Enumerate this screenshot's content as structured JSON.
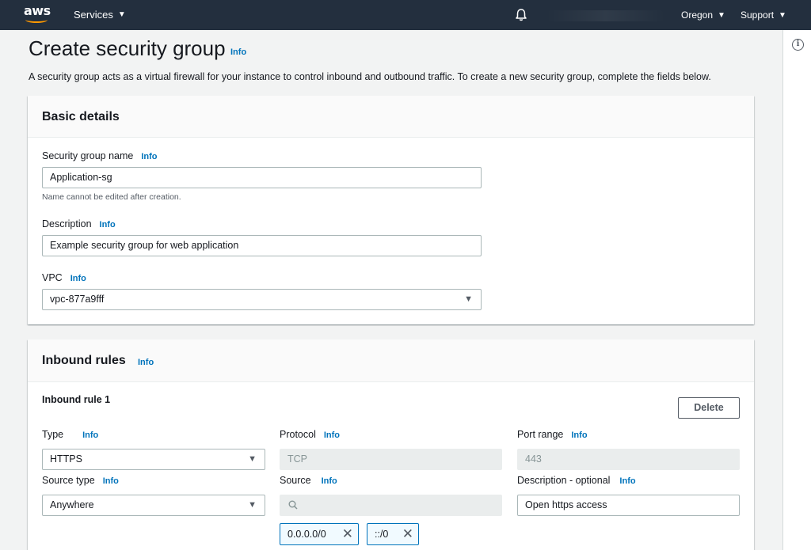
{
  "nav": {
    "services_label": "Services",
    "region_label": "Oregon",
    "support_label": "Support",
    "logo_text": "aws"
  },
  "colors": {
    "nav_bg": "#232f3e",
    "link": "#0073bb",
    "brand_orange": "#ff9900"
  },
  "icons": {
    "services_caret": "caret-down-icon",
    "bell": "bell-icon",
    "tools": "info-circle-icon",
    "select_caret": "caret-down-icon",
    "search": "search-icon",
    "token_remove": "close-icon"
  },
  "page": {
    "title": "Create security group",
    "info": "Info",
    "description": "A security group acts as a virtual firewall for your instance to control inbound and outbound traffic. To create a new security group, complete the fields below."
  },
  "basic_details": {
    "title": "Basic details",
    "name_label": "Security group name",
    "name_info": "Info",
    "name_value": "Application-sg",
    "name_hint": "Name cannot be edited after creation.",
    "description_label": "Description",
    "description_info": "Info",
    "description_value": "Example security group for web application",
    "vpc_label": "VPC",
    "vpc_info": "Info",
    "vpc_value": "vpc-877a9fff"
  },
  "inbound_rules": {
    "title": "Inbound rules",
    "info": "Info",
    "rule_title": "Inbound rule 1",
    "delete_label": "Delete",
    "type_label": "Type",
    "type_info": "Info",
    "type_value": "HTTPS",
    "protocol_label": "Protocol",
    "protocol_info": "Info",
    "protocol_value": "TCP",
    "port_label": "Port range",
    "port_info": "Info",
    "port_value": "443",
    "source_type_label": "Source type",
    "source_type_info": "Info",
    "source_type_value": "Anywhere",
    "source_label": "Source",
    "source_info": "Info",
    "source_tokens": [
      "0.0.0.0/0",
      "::/0"
    ],
    "rule_desc_label": "Description - optional",
    "rule_desc_info": "Info",
    "rule_desc_value": "Open https access"
  }
}
